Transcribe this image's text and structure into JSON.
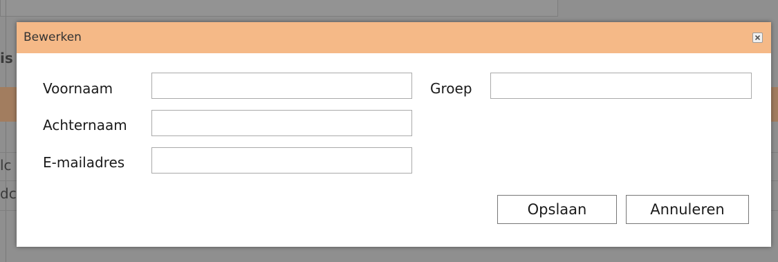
{
  "background": {
    "fragments": [
      "is",
      "lc",
      "dc"
    ]
  },
  "dialog": {
    "title": "Bewerken",
    "close_icon": "close-icon",
    "fields": {
      "voornaam": {
        "label": "Voornaam",
        "value": ""
      },
      "achternaam": {
        "label": "Achternaam",
        "value": ""
      },
      "email": {
        "label": "E-mailadres",
        "value": ""
      },
      "groep": {
        "label": "Groep",
        "value": ""
      }
    },
    "buttons": {
      "save": "Opslaan",
      "cancel": "Annuleren"
    },
    "colors": {
      "titlebar": "#f5b987",
      "overlay": "#8f8f8f"
    }
  }
}
